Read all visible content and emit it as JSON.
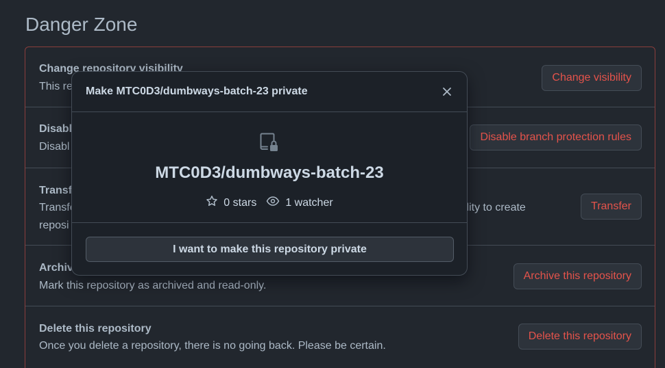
{
  "section": {
    "title": "Danger Zone"
  },
  "rows": [
    {
      "title": "Change repository visibility",
      "desc": "This re",
      "button": "Change visibility"
    },
    {
      "title": "Disabl",
      "desc": "Disabl",
      "button": "Disable branch protection rules"
    },
    {
      "title": "Transf",
      "desc_line1": "Transfe",
      "desc_line1_right": "ility to create",
      "desc_line2": "reposi",
      "button": "Transfer"
    },
    {
      "title": "Archiv",
      "desc": "Mark this repository as archived and read-only.",
      "button": "Archive this repository"
    },
    {
      "title": "Delete this repository",
      "desc": "Once you delete a repository, there is no going back. Please be certain.",
      "button": "Delete this repository"
    }
  ],
  "modal": {
    "title": "Make MTC0D3/dumbways-batch-23 private",
    "repo_name": "MTC0D3/dumbways-batch-23",
    "stars": "0 stars",
    "watchers": "1 watcher",
    "confirm_label": "I want to make this repository private",
    "icons": {
      "repo": "repo-locked-icon",
      "star": "star-icon",
      "watch": "eye-icon",
      "close": "close-icon"
    }
  },
  "colors": {
    "background": "#22272e",
    "danger": "#e5534b",
    "border": "#444c56",
    "danger_border": "#8b3e3c",
    "modal_bg": "#1c2128"
  }
}
